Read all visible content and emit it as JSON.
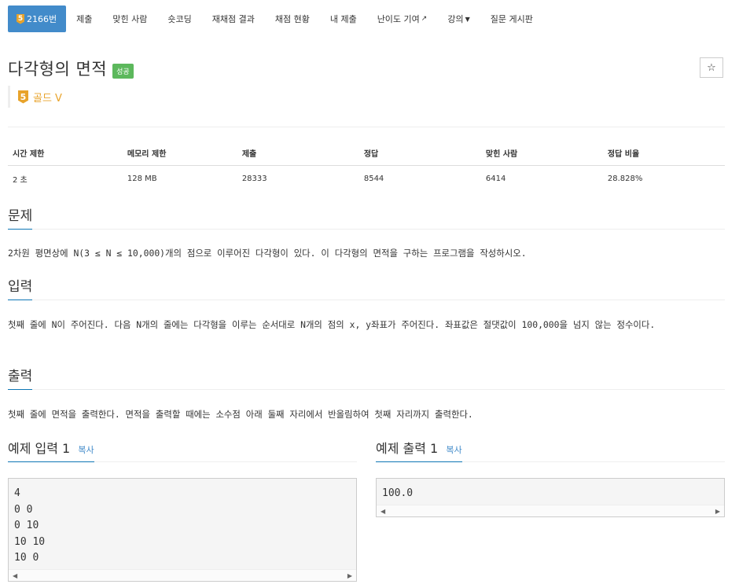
{
  "nav": {
    "problem_tier": "5",
    "problem_number": "2166번",
    "tabs": [
      "제출",
      "맞힌 사람",
      "숏코딩",
      "재채점 결과",
      "채점 현황",
      "내 제출",
      "난이도 기여",
      "강의",
      "질문 게시판"
    ]
  },
  "problem": {
    "title": "다각형의 면적",
    "result": "성공",
    "tier_num": "5",
    "tier_text": "골드 V",
    "star": "☆"
  },
  "info": {
    "headers": [
      "시간 제한",
      "메모리 제한",
      "제출",
      "정답",
      "맞힌 사람",
      "정답 비율"
    ],
    "values": [
      "2 초",
      "128 MB",
      "28333",
      "8544",
      "6414",
      "28.828%"
    ]
  },
  "sections": {
    "problem_title": "문제",
    "problem_text": "2차원 평면상에 N(3 ≤ N ≤ 10,000)개의 점으로 이루어진 다각형이 있다. 이 다각형의 면적을 구하는 프로그램을 작성하시오.",
    "input_title": "입력",
    "input_text": "첫째 줄에 N이 주어진다. 다음 N개의 줄에는 다각형을 이루는 순서대로 N개의 점의 x, y좌표가 주어진다. 좌표값은 절댓값이 100,000을 넘지 않는 정수이다.",
    "output_title": "출력",
    "output_text": "첫째 줄에 면적을 출력한다. 면적을 출력할 때에는 소수점 아래 둘째 자리에서 반올림하여 첫째 자리까지 출력한다."
  },
  "samples": {
    "input_title": "예제 입력 1",
    "output_title": "예제 출력 1",
    "copy_label": "복사",
    "input_text": "4\n0 0\n0 10\n10 10\n10 0",
    "output_text": "100.0"
  },
  "colors": {
    "primary": "#428bca",
    "success": "#5cb85c",
    "gold": "#e8a32b"
  }
}
